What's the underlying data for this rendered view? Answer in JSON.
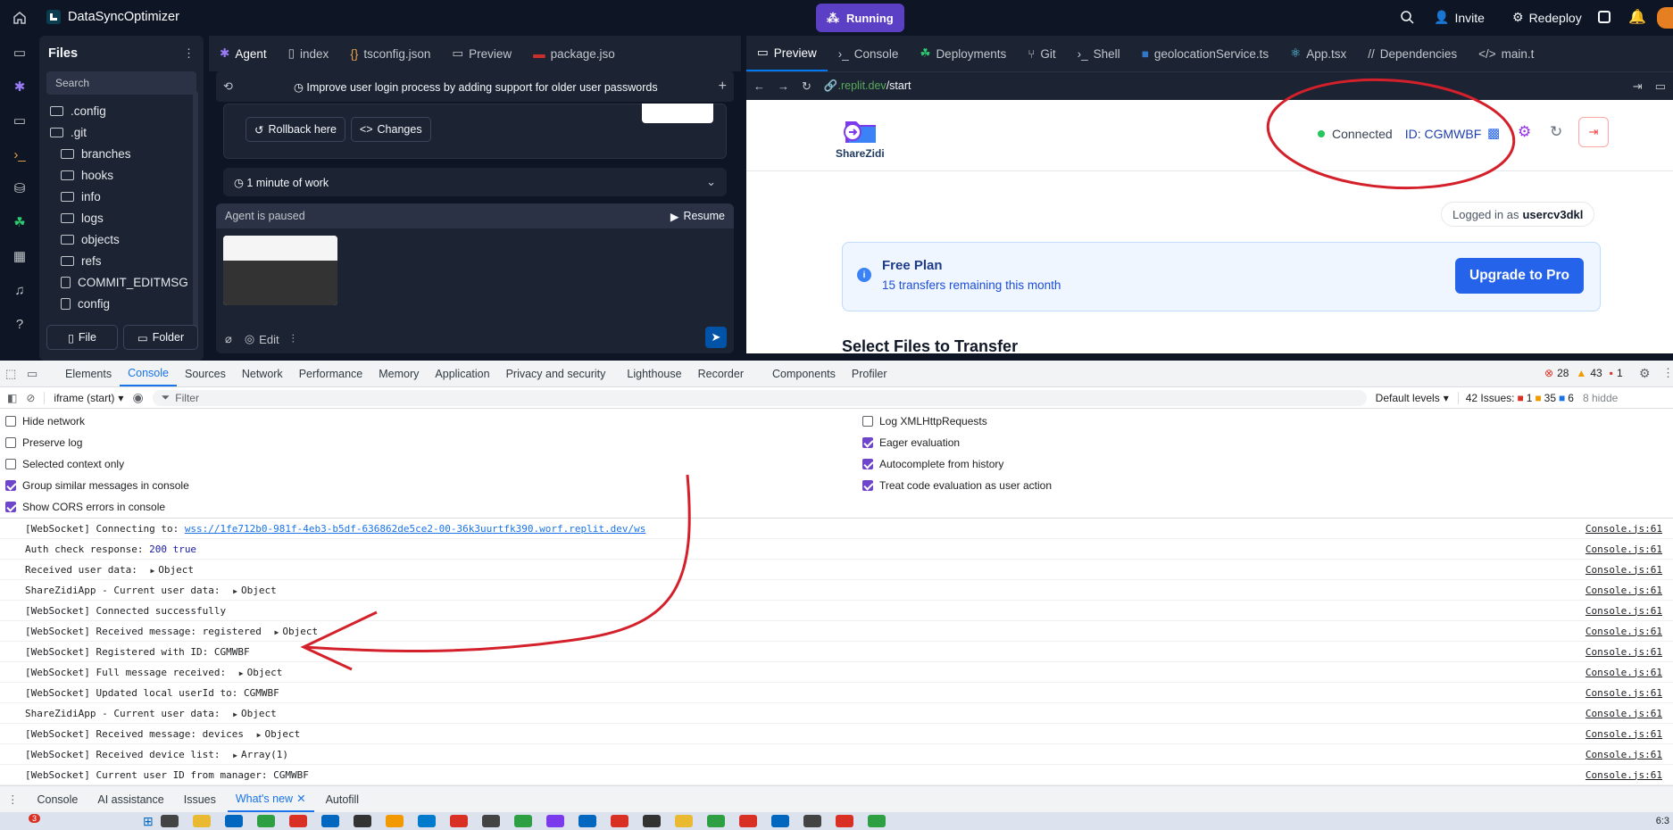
{
  "app": {
    "title": "DataSyncOptimizer",
    "status": "Running",
    "invite": "Invite",
    "redeploy": "Redeploy"
  },
  "files": {
    "title": "Files",
    "search_placeholder": "Search",
    "items": [
      ".config",
      ".git",
      "branches",
      "hooks",
      "info",
      "logs",
      "objects",
      "refs",
      "COMMIT_EDITMSG",
      "config"
    ],
    "new_file": "File",
    "new_folder": "Folder"
  },
  "agent": {
    "tabs": [
      "Agent",
      "index",
      "tsconfig.json",
      "Preview",
      "package.jso"
    ],
    "task_title": "Improve user login process by adding support for older user passwords",
    "rollback": "Rollback here",
    "changes": "Changes",
    "work_time": "1 minute of work",
    "paused": "Agent is paused",
    "resume": "Resume",
    "edit": "Edit"
  },
  "preview": {
    "tabs": [
      "Preview",
      "Console",
      "Deployments",
      "Git",
      "Shell",
      "geolocationService.ts",
      "App.tsx",
      "Dependencies",
      "main.t"
    ],
    "url_host": ".replit.dev",
    "url_path": "/start",
    "logo_text": "ShareZidi",
    "connected": "Connected",
    "id_label": "ID: CGMWBF",
    "logged_prefix": "Logged in as",
    "logged_user": "usercv3dkl",
    "plan_title": "Free Plan",
    "plan_sub": "15 transfers remaining this month",
    "upgrade": "Upgrade to Pro",
    "section": "Select Files to Transfer"
  },
  "devtools": {
    "tabs": [
      "Elements",
      "Console",
      "Sources",
      "Network",
      "Performance",
      "Memory",
      "Application",
      "Privacy and security",
      "Lighthouse",
      "Recorder",
      "Components",
      "Profiler"
    ],
    "errors": "28",
    "warnings": "43",
    "infos": "1",
    "context": "iframe (start)",
    "filter_placeholder": "Filter",
    "levels": "Default levels",
    "issues_label": "42 Issues:",
    "issues_err": "1",
    "issues_warn": "35",
    "issues_info": "6",
    "hidden": "8 hidde",
    "left_opts": [
      {
        "label": "Hide network",
        "on": false
      },
      {
        "label": "Preserve log",
        "on": false
      },
      {
        "label": "Selected context only",
        "on": false
      },
      {
        "label": "Group similar messages in console",
        "on": true
      },
      {
        "label": "Show CORS errors in console",
        "on": true
      }
    ],
    "right_opts": [
      {
        "label": "Log XMLHttpRequests",
        "on": false
      },
      {
        "label": "Eager evaluation",
        "on": true
      },
      {
        "label": "Autocomplete from history",
        "on": true
      },
      {
        "label": "Treat code evaluation as user action",
        "on": true
      }
    ],
    "logs": [
      {
        "text": "[WebSocket] Connecting to: ",
        "link": "wss://1fe712b0-981f-4eb3-b5df-636862de5ce2-00-36k3uurtfk390.worf.replit.dev/ws",
        "obj": ""
      },
      {
        "text": "Auth check response: ",
        "num": "200 true",
        "obj": ""
      },
      {
        "text": "Received user data: ",
        "obj": "Object"
      },
      {
        "text": "ShareZidiApp - Current user data: ",
        "obj": "Object"
      },
      {
        "text": "[WebSocket] Connected successfully",
        "obj": ""
      },
      {
        "text": "[WebSocket] Received message: registered ",
        "obj": "Object"
      },
      {
        "text": "[WebSocket] Registered with ID: CGMWBF",
        "obj": ""
      },
      {
        "text": "[WebSocket] Full message received: ",
        "obj": "Object"
      },
      {
        "text": "[WebSocket] Updated local userId to: CGMWBF",
        "obj": ""
      },
      {
        "text": "ShareZidiApp - Current user data: ",
        "obj": "Object"
      },
      {
        "text": "[WebSocket] Received message: devices ",
        "obj": "Object"
      },
      {
        "text": "[WebSocket] Received device list: ",
        "obj": "Array(1)"
      },
      {
        "text": "[WebSocket] Current user ID from manager: CGMWBF",
        "obj": ""
      }
    ],
    "log_source": "Console.js:61",
    "drawer_tabs": [
      "Console",
      "AI assistance",
      "Issues",
      "What's new",
      "Autofill"
    ]
  },
  "taskbar": {
    "badge": "3",
    "clock": "6:3"
  },
  "colors": {
    "accent": "#5b3fc4",
    "link": "#1a73e8",
    "annotation": "#d4202a",
    "upgrade": "#2563eb"
  }
}
